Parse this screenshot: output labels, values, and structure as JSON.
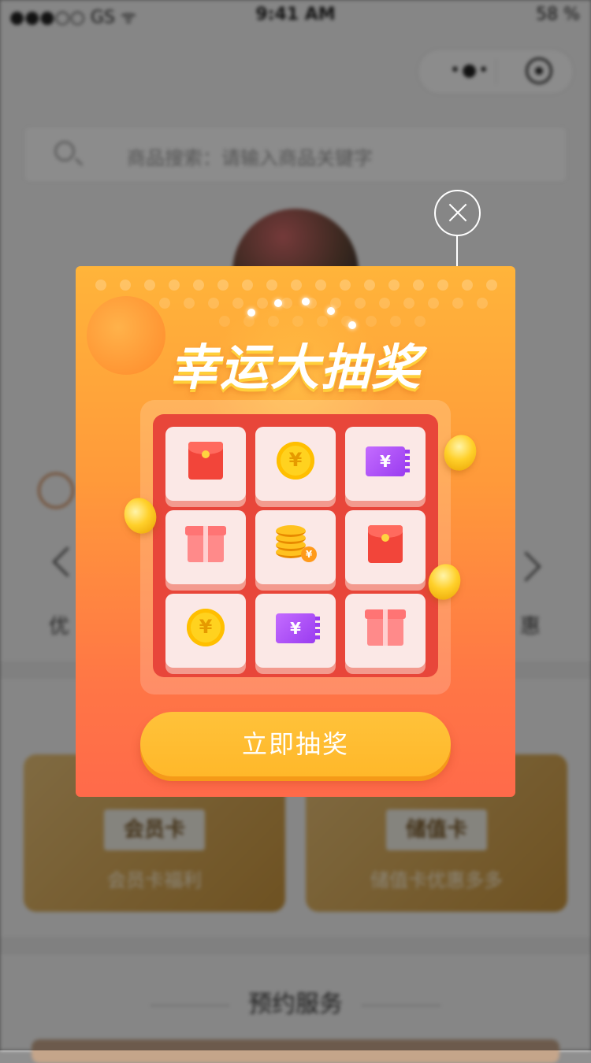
{
  "status_bar": {
    "carrier": "●●●○○ GS ᯤ",
    "time": "9:41 AM",
    "battery": "58 %"
  },
  "capsule": {
    "more_icon": "more-dots-icon",
    "close_icon": "close-mini-program-icon"
  },
  "search": {
    "placeholder": "商品搜索：请输入商品关键字"
  },
  "background": {
    "left_label": "优",
    "right_label": "惠",
    "cards": [
      {
        "badge": "会员卡",
        "subtitle": "会员卡福利"
      },
      {
        "badge": "储值卡",
        "subtitle": "储值卡优惠多多"
      }
    ],
    "section_title": "预约服务"
  },
  "lottery": {
    "title": "幸运大抽奖",
    "button_label": "立即抽奖",
    "close_icon": "close-circle-icon",
    "prizes": [
      {
        "type": "red-envelope",
        "label": ""
      },
      {
        "type": "coin",
        "label": "¥"
      },
      {
        "type": "coupon",
        "label": "¥"
      },
      {
        "type": "gift",
        "label": ""
      },
      {
        "type": "coin-stack",
        "label": "¥"
      },
      {
        "type": "red-envelope",
        "label": ""
      },
      {
        "type": "coin",
        "label": "¥"
      },
      {
        "type": "coupon",
        "label": "¥"
      },
      {
        "type": "gift",
        "label": ""
      }
    ],
    "colors": {
      "gradient_top": "#ffb43a",
      "gradient_bottom": "#ff6a4a",
      "board": "#e8463a",
      "cell": "#fbe8e6",
      "button": "#ffc23a"
    }
  }
}
